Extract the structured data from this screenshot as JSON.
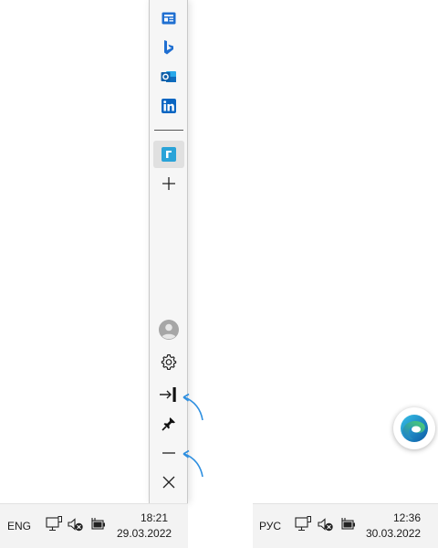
{
  "sidebar": {
    "apps": [
      {
        "name": "news-icon",
        "color": "#1f6fd1"
      },
      {
        "name": "bing-icon",
        "color": "#1f6fd1"
      },
      {
        "name": "outlook-icon",
        "color": "#0f6cbd"
      },
      {
        "name": "linkedin-icon",
        "color": "#0a66c2"
      },
      {
        "name": "reader-app-icon",
        "color": "#2aa3d8"
      }
    ],
    "controls": [
      {
        "name": "add-icon"
      },
      {
        "name": "profile-icon"
      },
      {
        "name": "settings-gear-icon"
      },
      {
        "name": "collapse-panel-icon"
      },
      {
        "name": "pin-icon"
      },
      {
        "name": "minimize-icon"
      },
      {
        "name": "close-icon"
      }
    ]
  },
  "annotation_color": "#2e8fe0",
  "taskbar_left": {
    "language": "ENG",
    "time": "18:21",
    "date": "29.03.2022"
  },
  "taskbar_right": {
    "language": "РУС",
    "time": "12:36",
    "date": "30.03.2022"
  }
}
